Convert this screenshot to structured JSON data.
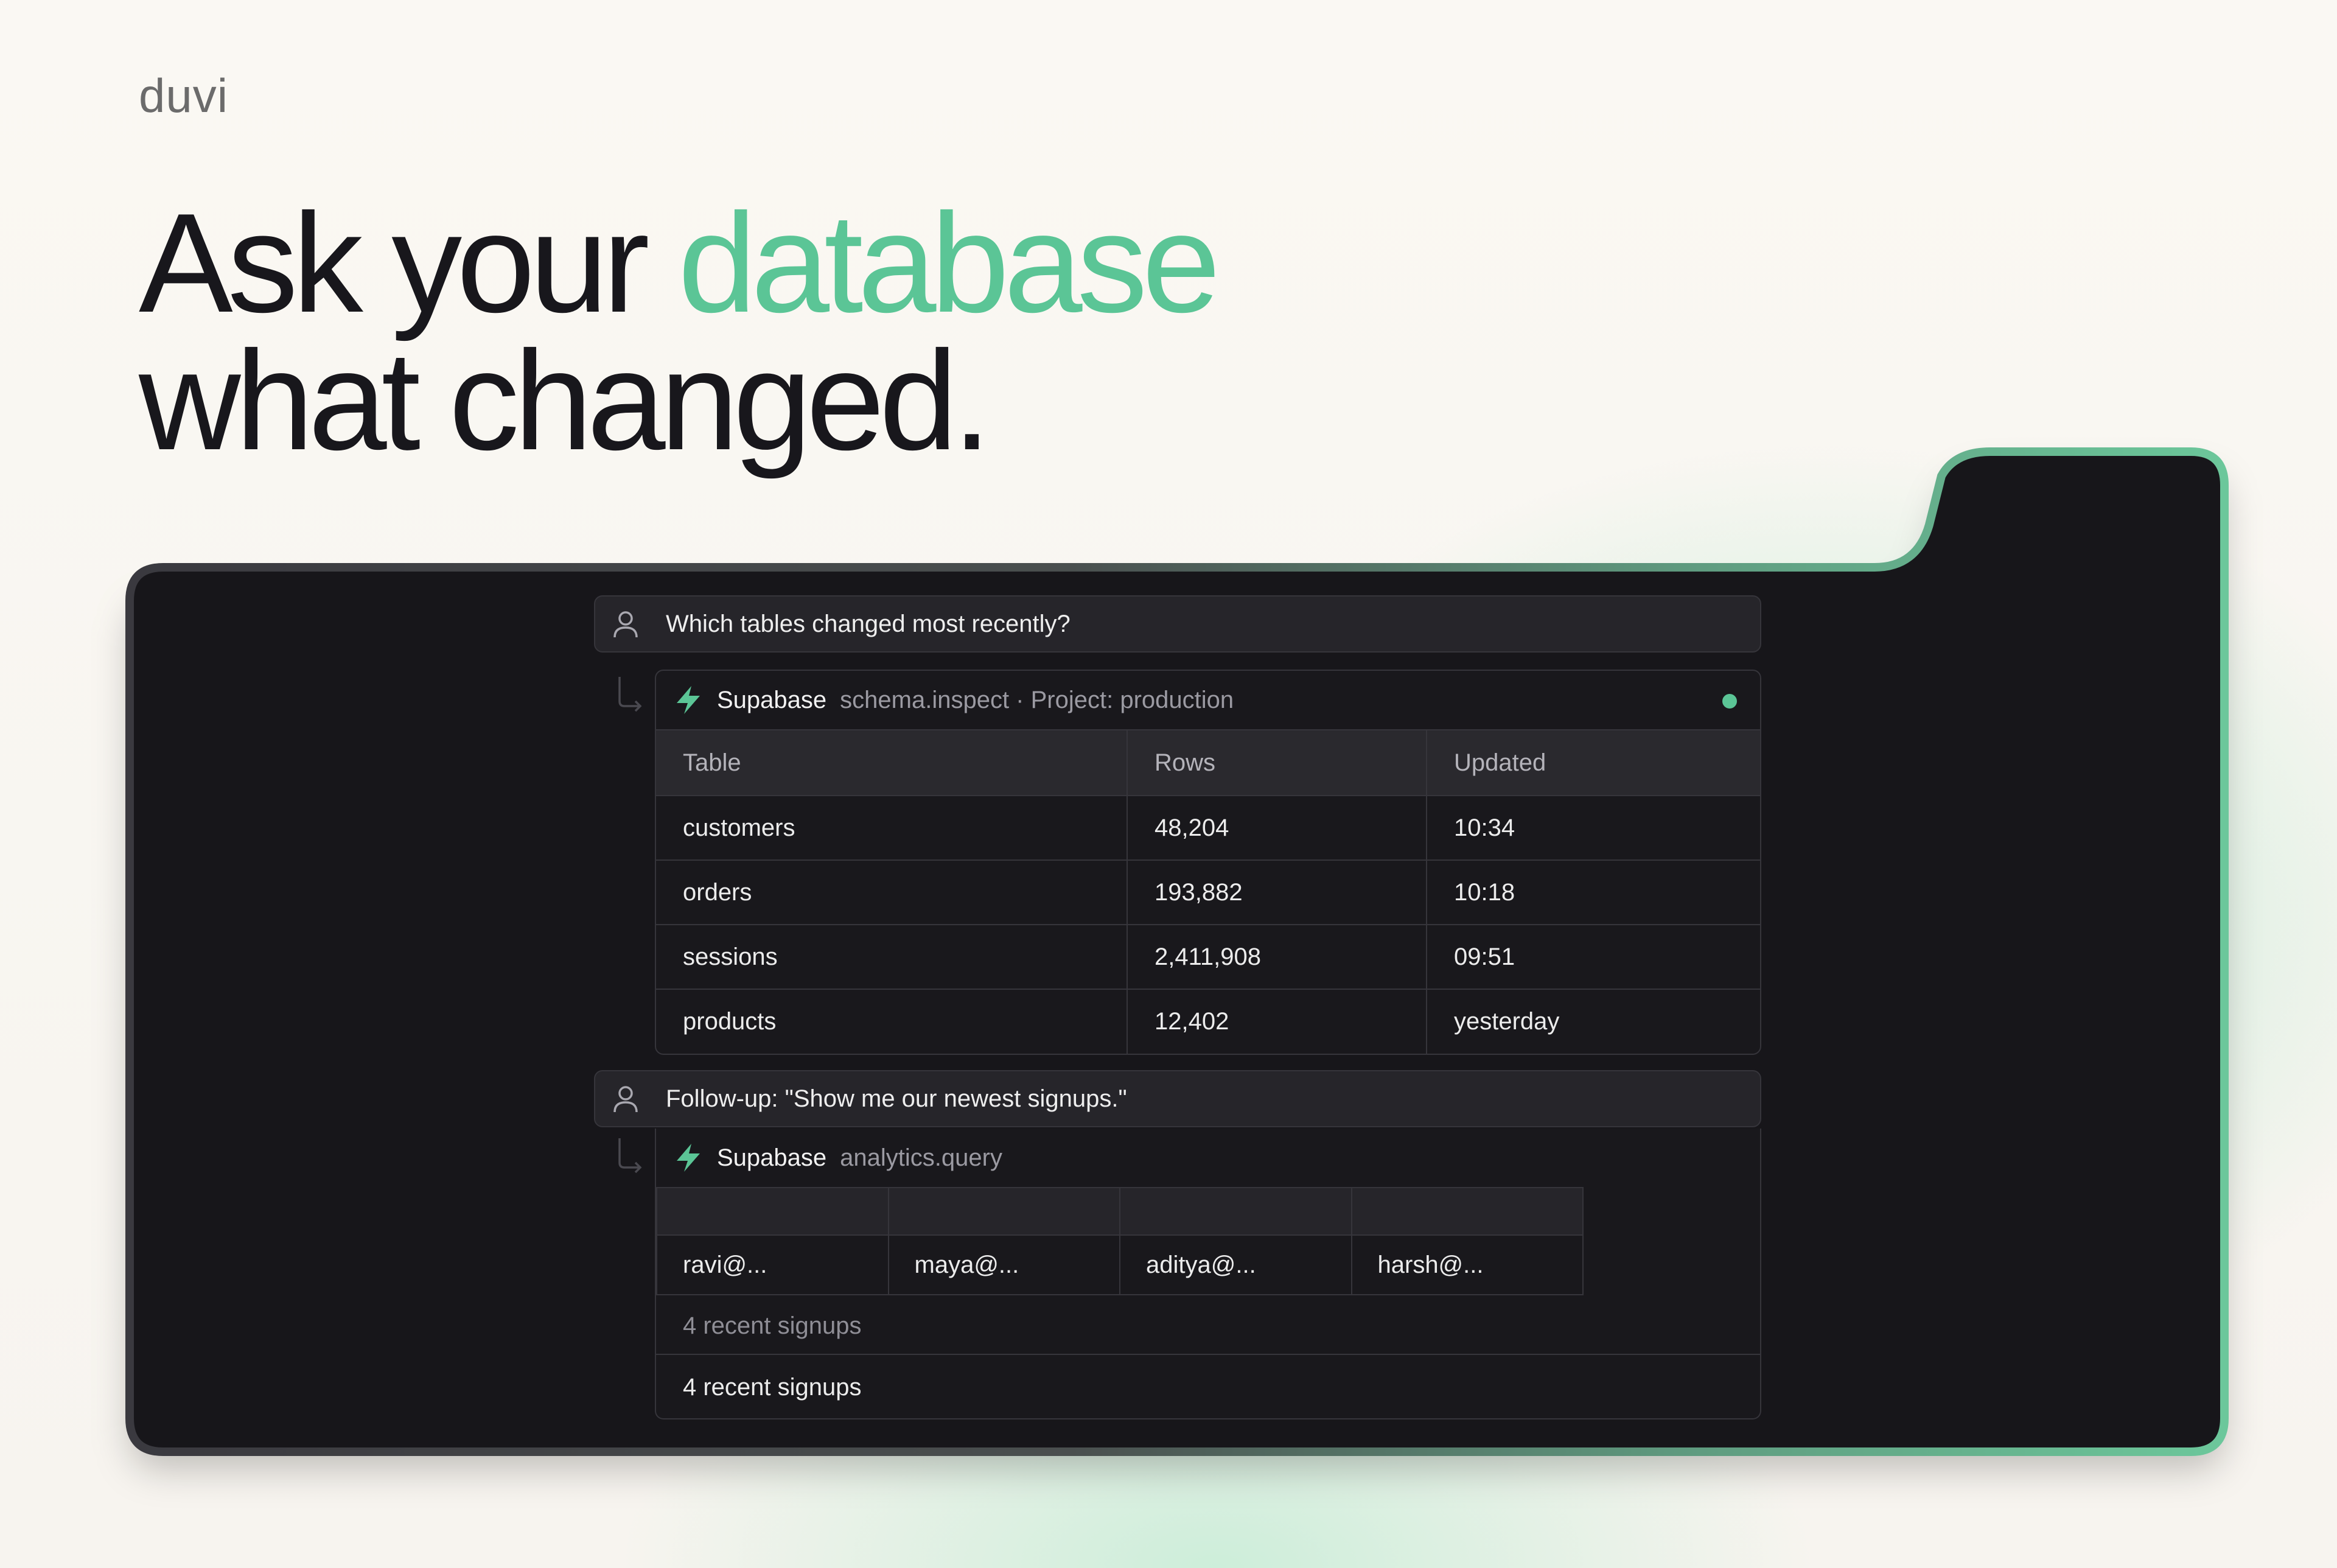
{
  "brand": "duvi",
  "headline": {
    "line1_before": "Ask your ",
    "line1_accent": "database",
    "line2": "what changed."
  },
  "colors": {
    "accent": "#5bc596",
    "panel_bg": "#17161a",
    "headline": "#18171c"
  },
  "chat": {
    "question1": "Which tables changed most recently?",
    "tool1": {
      "name": "Supabase",
      "detail": "schema.inspect · Project: production",
      "status": "connected",
      "columns": [
        "Table",
        "Rows",
        "Updated"
      ],
      "rows": [
        [
          "customers",
          "48,204",
          "10:34"
        ],
        [
          "orders",
          "193,882",
          "10:18"
        ],
        [
          "sessions",
          "2,411,908",
          "09:51"
        ],
        [
          "products",
          "12,402",
          "yesterday"
        ]
      ]
    },
    "question2": "Follow-up: \"Show me our newest signups.\"",
    "tool2": {
      "name": "Supabase",
      "detail": "analytics.query",
      "signups": [
        "ravi@...",
        "maya@...",
        "aditya@...",
        "harsh@..."
      ],
      "caption": "4 recent signups",
      "summary": "4 recent signups"
    }
  },
  "icons": [
    "user-icon",
    "reply-arrow-icon",
    "bolt-icon",
    "status-dot-icon"
  ]
}
